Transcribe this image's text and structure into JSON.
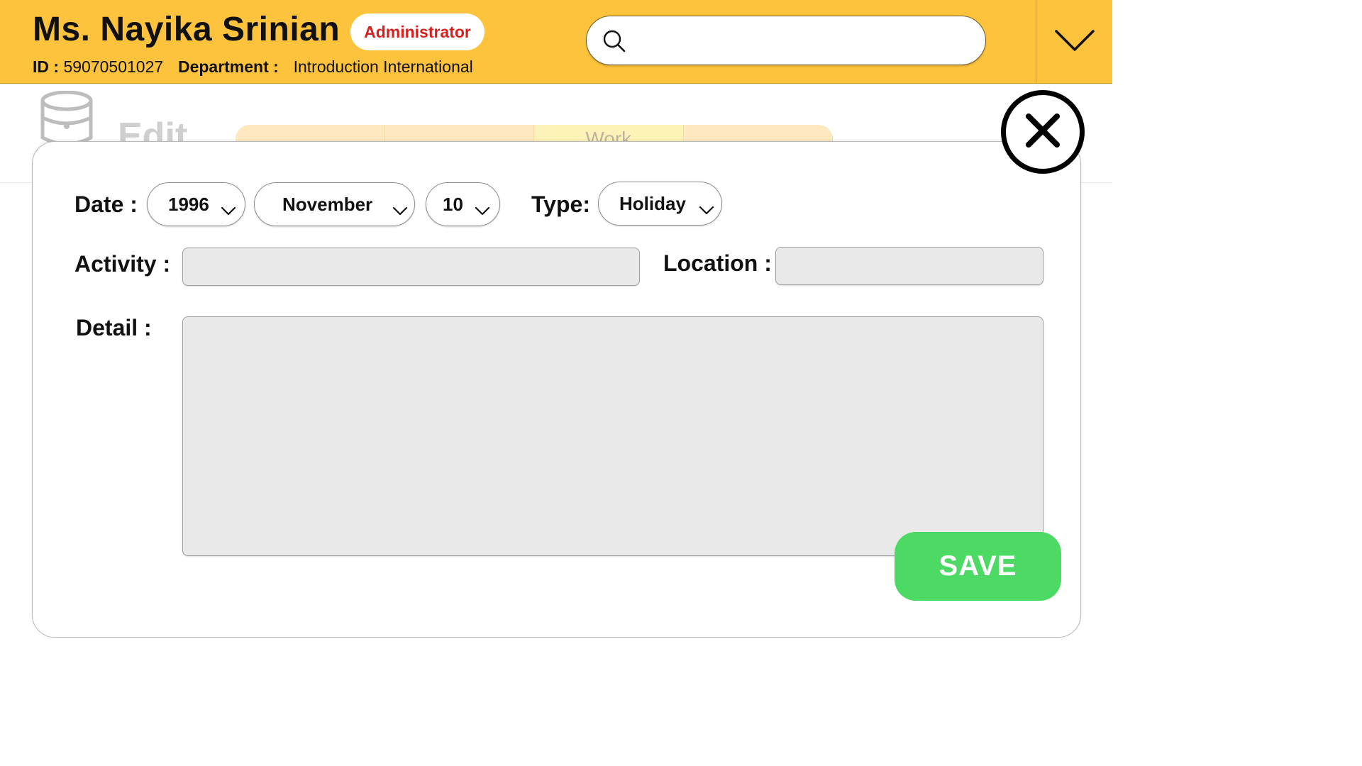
{
  "header": {
    "user_name": "Ms. Nayika Srinian",
    "role": "Administrator",
    "id_label": "ID :",
    "id_value": "59070501027",
    "department_label": "Department :",
    "department_value": "Introduction International",
    "search": {
      "placeholder": "",
      "icon": "search-icon"
    },
    "menu_icon": "chevron-down-icon",
    "background_color": "#fec33c"
  },
  "background_page": {
    "title": "Edit",
    "tabs": [
      "",
      "",
      "Work",
      ""
    ],
    "active_tab_index": 2
  },
  "modal": {
    "date_label": "Date :",
    "year": "1996",
    "month": "November",
    "day": "10",
    "type_label": "Type:",
    "type_value": "Holiday",
    "activity_label": "Activity :",
    "activity_value": "",
    "location_label": "Location :",
    "location_value": "",
    "detail_label": "Detail :",
    "detail_value": "",
    "save_label": "SAVE",
    "close_icon": "close-circle-icon"
  },
  "colors": {
    "accent_yellow": "#fec33c",
    "role_red": "#d62020",
    "save_green": "#4cd964",
    "field_gray": "#e9e9e9"
  }
}
